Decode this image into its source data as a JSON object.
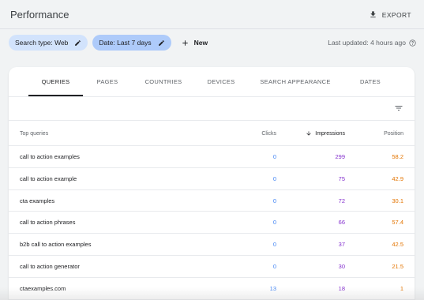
{
  "header": {
    "title": "Performance",
    "export_label": "EXPORT"
  },
  "filters": {
    "search_type": "Search type: Web",
    "date": "Date: Last 7 days",
    "new_label": "New",
    "last_updated": "Last updated: 4 hours ago"
  },
  "tabs": [
    "QUERIES",
    "PAGES",
    "COUNTRIES",
    "DEVICES",
    "SEARCH APPEARANCE",
    "DATES"
  ],
  "table": {
    "columns": {
      "query": "Top queries",
      "clicks": "Clicks",
      "impressions": "Impressions",
      "position": "Position"
    },
    "rows": [
      {
        "query": "call to action examples",
        "clicks": "0",
        "impressions": "299",
        "position": "58.2"
      },
      {
        "query": "call to action example",
        "clicks": "0",
        "impressions": "75",
        "position": "42.9"
      },
      {
        "query": "cta examples",
        "clicks": "0",
        "impressions": "72",
        "position": "30.1"
      },
      {
        "query": "call to action phrases",
        "clicks": "0",
        "impressions": "66",
        "position": "57.4"
      },
      {
        "query": "b2b call to action examples",
        "clicks": "0",
        "impressions": "37",
        "position": "42.5"
      },
      {
        "query": "call to action generator",
        "clicks": "0",
        "impressions": "30",
        "position": "21.5"
      },
      {
        "query": "ctaexamples.com",
        "clicks": "13",
        "impressions": "18",
        "position": "1"
      }
    ]
  },
  "colors": {
    "clicks": "#4285f4",
    "impressions": "#8430ce",
    "position": "#e37400",
    "chip_type": "#d2e3fc",
    "chip_date": "#aecbfa"
  },
  "icons": [
    "download-icon",
    "pencil-icon",
    "plus-icon",
    "help-icon",
    "filter-icon",
    "arrow-down-icon"
  ]
}
